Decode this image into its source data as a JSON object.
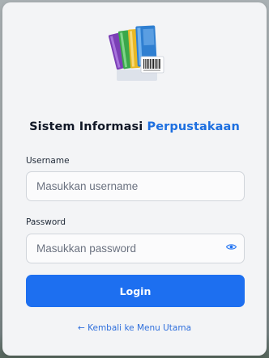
{
  "header": {
    "logo_icon": "books-barcode-icon",
    "title_prefix": "Sistem Informasi",
    "title_accent": "Perpustakaan"
  },
  "form": {
    "username_label": "Username",
    "username_placeholder": "Masukkan username",
    "username_value": "",
    "password_label": "Password",
    "password_placeholder": "Masukkan password",
    "password_value": "",
    "password_toggle_icon": "eye-icon",
    "login_label": "Login"
  },
  "footer": {
    "back_link": "← Kembali ke Menu Utama"
  },
  "colors": {
    "accent": "#1d6ff0",
    "title_accent": "#1d6fe0",
    "card_background": "#f3f4f6"
  }
}
